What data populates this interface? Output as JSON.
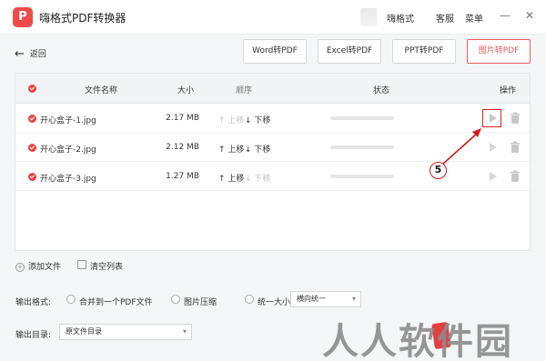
{
  "app": {
    "logo": "P",
    "title": "嗨格式PDF转换器"
  },
  "topmenu": {
    "brand": "嗨格式",
    "service": "客服",
    "menu": "菜单"
  },
  "nav": {
    "back": "返回",
    "tabs": [
      {
        "label": "Word转PDF",
        "active": false
      },
      {
        "label": "Excel转PDF",
        "active": false
      },
      {
        "label": "PPT转PDF",
        "active": false
      },
      {
        "label": "图片转PDF",
        "active": true
      }
    ]
  },
  "table": {
    "headers": {
      "name": "文件名称",
      "size": "大小",
      "order": "顺序",
      "status": "状态",
      "action": "操作"
    },
    "rows": [
      {
        "name": "开心盒子-1.jpg",
        "size": "2.17 MB",
        "up": "上移",
        "down": "下移",
        "up_enabled": false,
        "down_enabled": true
      },
      {
        "name": "开心盒子-2.jpg",
        "size": "2.12 MB",
        "up": "上移",
        "down": "下移",
        "up_enabled": true,
        "down_enabled": true
      },
      {
        "name": "开心盒子-3.jpg",
        "size": "1.27 MB",
        "up": "上移",
        "down": "下移",
        "up_enabled": true,
        "down_enabled": false
      }
    ]
  },
  "actions": {
    "add": "添加文件",
    "clear": "清空列表"
  },
  "output": {
    "format_label": "输出格式:",
    "merge": "合并到一个PDF文件",
    "compress": "图片压缩",
    "uniform_size": "统一大小:",
    "size_select": "横向统一",
    "dir_label": "输出目录:",
    "dir_select": "原文件目录"
  },
  "annotation": {
    "step": "5"
  },
  "watermark": {
    "text": "人人软件园"
  },
  "colors": {
    "accent": "#e84545",
    "annotation": "#d61a1a"
  }
}
